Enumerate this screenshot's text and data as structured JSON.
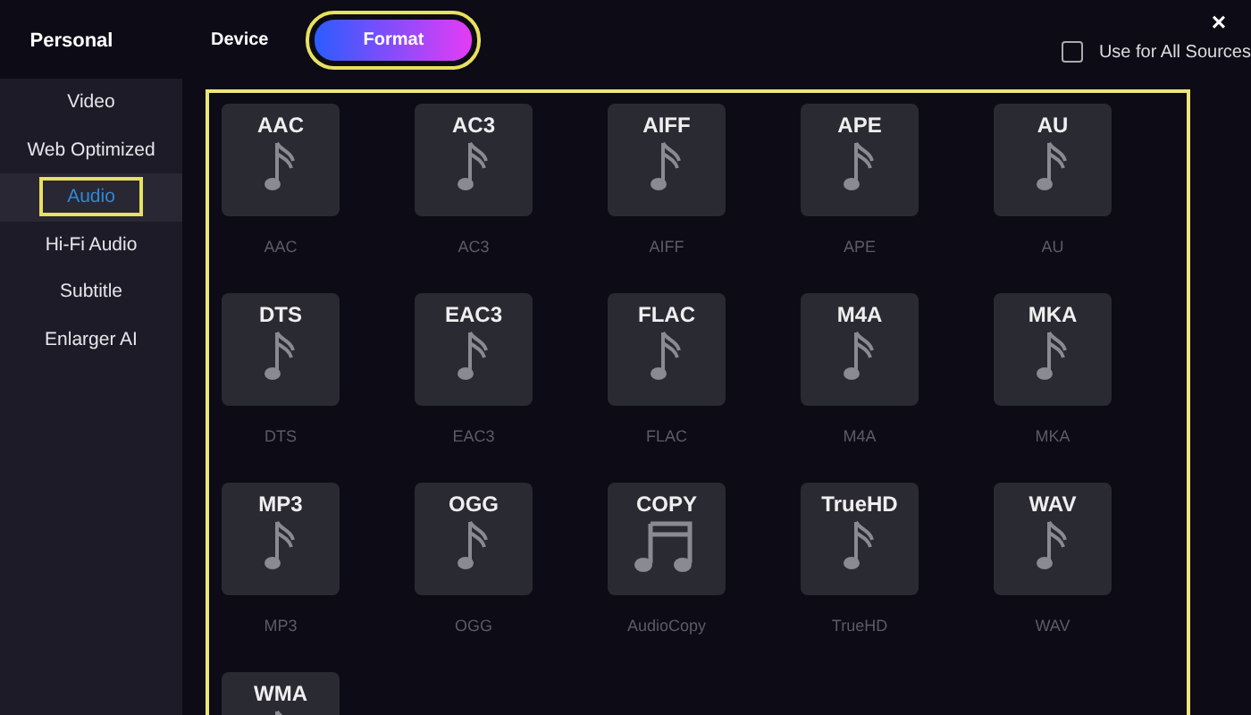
{
  "header": {
    "title": "Personal",
    "close": "×"
  },
  "tabs": [
    {
      "label": "Device",
      "selected": false
    },
    {
      "label": "Format",
      "selected": true
    }
  ],
  "use_for_all": {
    "label": "Use for All Sources",
    "checked": false
  },
  "sidebar": {
    "items": [
      {
        "label": "Video",
        "selected": false
      },
      {
        "label": "Web Optimized",
        "selected": false
      },
      {
        "label": "Audio",
        "selected": true
      },
      {
        "label": "Hi-Fi Audio",
        "selected": false
      },
      {
        "label": "Subtitle",
        "selected": false
      },
      {
        "label": "Enlarger AI",
        "selected": false
      }
    ]
  },
  "formats": [
    {
      "title": "AAC",
      "caption": "AAC",
      "kind": "note"
    },
    {
      "title": "AC3",
      "caption": "AC3",
      "kind": "note"
    },
    {
      "title": "AIFF",
      "caption": "AIFF",
      "kind": "note"
    },
    {
      "title": "APE",
      "caption": "APE",
      "kind": "note"
    },
    {
      "title": "AU",
      "caption": "AU",
      "kind": "note"
    },
    {
      "title": "DTS",
      "caption": "DTS",
      "kind": "note"
    },
    {
      "title": "EAC3",
      "caption": "EAC3",
      "kind": "note"
    },
    {
      "title": "FLAC",
      "caption": "FLAC",
      "kind": "note"
    },
    {
      "title": "M4A",
      "caption": "M4A",
      "kind": "note"
    },
    {
      "title": "MKA",
      "caption": "MKA",
      "kind": "note"
    },
    {
      "title": "MP3",
      "caption": "MP3",
      "kind": "note"
    },
    {
      "title": "OGG",
      "caption": "OGG",
      "kind": "note"
    },
    {
      "title": "COPY",
      "caption": "AudioCopy",
      "kind": "double"
    },
    {
      "title": "TrueHD",
      "caption": "TrueHD",
      "kind": "note"
    },
    {
      "title": "WAV",
      "caption": "WAV",
      "kind": "note"
    },
    {
      "title": "WMA",
      "kind": "note"
    }
  ]
}
